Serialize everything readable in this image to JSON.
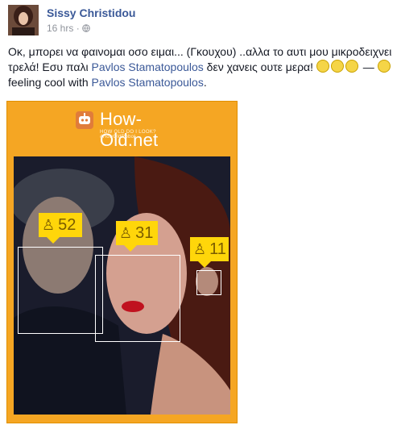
{
  "post": {
    "author": "Sissy Christidou",
    "time": "16 hrs",
    "separator": " · ",
    "privacy_icon": "globe-icon",
    "text_part1": "Οκ, μπορει να φαινομαι οσο ειμαι... (Γκουχου) ..αλλα το αυτι μου μικροδειχνει τρελά! Εσυ παλι ",
    "mention1": "Pavlos Stamatopoulos",
    "text_part2": " δεν χανεις ουτε μερα! ",
    "dash": " — ",
    "feeling_text": "feeling cool with ",
    "mention2": "Pavlos Stamatopoulos",
    "end_period": "."
  },
  "photo": {
    "brand_title": "How-Old.net",
    "brand_tagline": "HOW OLD DO I LOOK? #HowOldRobot",
    "background_color": "#f5a623",
    "tags": [
      {
        "age": "52",
        "icon": "male-person-icon"
      },
      {
        "age": "31",
        "icon": "female-person-icon"
      },
      {
        "age": "11",
        "icon": "female-person-icon"
      }
    ]
  }
}
